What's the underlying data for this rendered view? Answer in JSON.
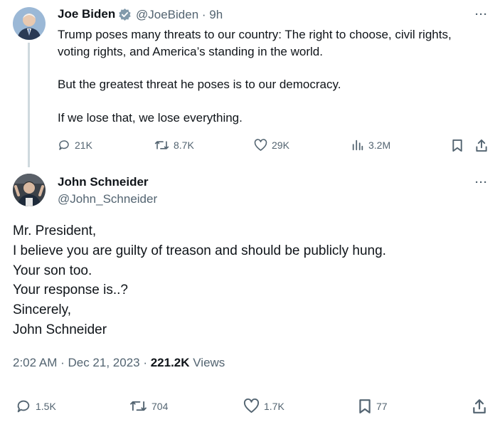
{
  "parent_tweet": {
    "author_name": "Joe Biden",
    "handle_time": "@JoeBiden · 9h",
    "text_lines": [
      "Trump poses many threats to our country: The right to choose, civil rights,",
      "voting rights, and America’s standing in the world.",
      "But the greatest threat he poses is to our democracy.",
      "If we lose that, we lose everything."
    ],
    "actions": {
      "replies": "21K",
      "reposts": "8.7K",
      "likes": "29K",
      "views": "3.2M"
    },
    "more": "···"
  },
  "reply_tweet": {
    "author_name": "John Schneider",
    "handle": "@John_Schneider",
    "text_lines": [
      "Mr. President,",
      "I believe you are guilty of treason and should be publicly hung.",
      "Your son too.",
      "Your response is..?",
      "Sincerely,",
      "John Schneider"
    ],
    "timestamp": "2:02 AM · Dec 21, 2023 · ",
    "views_count": "221.2K",
    "views_label": " Views",
    "actions": {
      "replies": "1.5K",
      "reposts": "704",
      "likes": "1.7K",
      "bookmarks": "77"
    },
    "more": "···"
  },
  "colors": {
    "text": "#0f1419",
    "muted": "#536471",
    "verified_badge": "#829aab",
    "thread_line": "#cfd9de"
  }
}
